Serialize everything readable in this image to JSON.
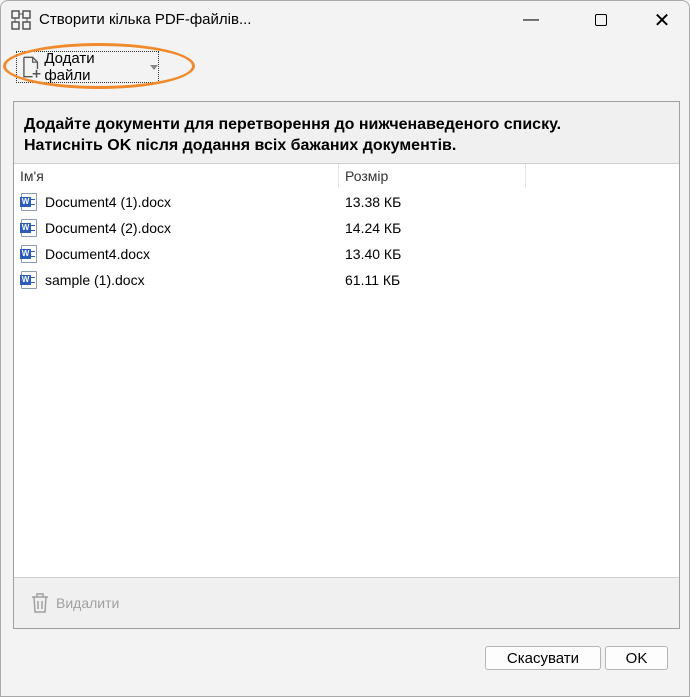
{
  "window": {
    "title": "Створити кілька PDF-файлів..."
  },
  "toolbar": {
    "add_files_label": "Додати файли"
  },
  "instructions": {
    "line1": "Додайте документи для перетворення до нижченаведеного списку.",
    "line2": "Натисніть OK після додання всіх бажаних документів."
  },
  "list": {
    "columns": [
      "Ім'я",
      "Розмір"
    ],
    "rows": [
      {
        "name": "Document4 (1).docx",
        "size": "13.38 КБ"
      },
      {
        "name": "Document4 (2).docx",
        "size": "14.24 КБ"
      },
      {
        "name": "Document4.docx",
        "size": "13.40 КБ"
      },
      {
        "name": "sample (1).docx",
        "size": "61.11 КБ"
      }
    ]
  },
  "delete_label": "Видалити",
  "footer": {
    "cancel": "Скасувати",
    "ok": "OK"
  },
  "colors": {
    "highlight": "#f08a2c",
    "word": "#2b5db8"
  }
}
